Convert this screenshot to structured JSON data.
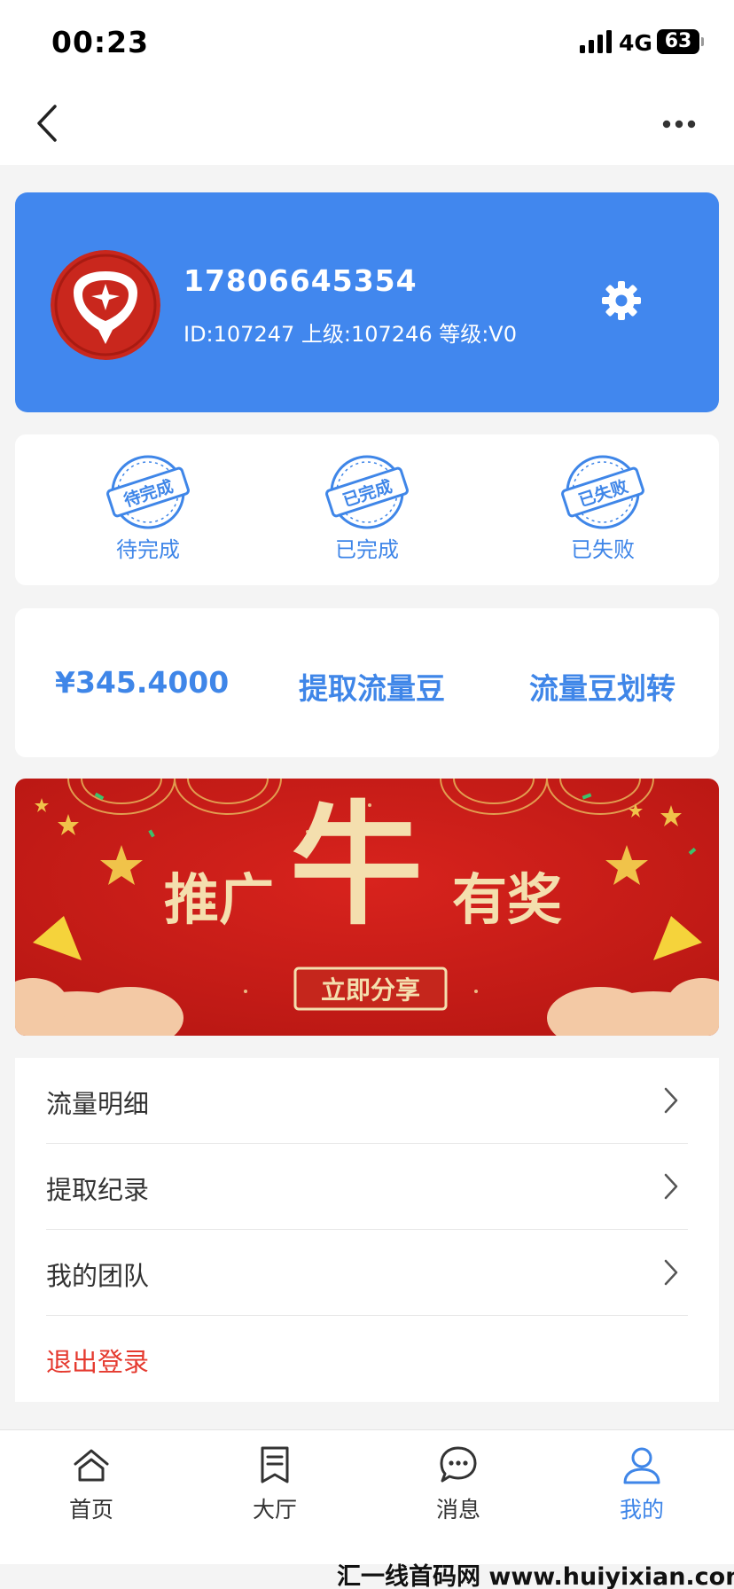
{
  "status_bar": {
    "time": "00:23",
    "network": "4G",
    "battery": "63"
  },
  "profile": {
    "phone": "17806645354",
    "meta": "ID:107247 上级:107246 等级:V0",
    "colors": {
      "card": "#4187ee"
    }
  },
  "orders": [
    {
      "stamp": "待完成",
      "label": "待完成"
    },
    {
      "stamp": "已完成",
      "label": "已完成"
    },
    {
      "stamp": "已失败",
      "label": "已失败"
    }
  ],
  "wallet": {
    "balance": "¥345.4000",
    "withdraw_label": "提取流量豆",
    "transfer_label": "流量豆划转"
  },
  "banner": {
    "title_left": "推广",
    "title_big": "牛",
    "title_right": "有奖",
    "button": "立即分享"
  },
  "menu": [
    {
      "label": "流量明细"
    },
    {
      "label": "提取纪录"
    },
    {
      "label": "我的团队"
    },
    {
      "label": "退出登录"
    }
  ],
  "tabbar": [
    {
      "label": "首页",
      "icon": "home-icon"
    },
    {
      "label": "大厅",
      "icon": "document-icon"
    },
    {
      "label": "消息",
      "icon": "chat-icon"
    },
    {
      "label": "我的",
      "icon": "user-icon"
    }
  ],
  "watermark": "汇一线首码网 www.huiyixian.com"
}
